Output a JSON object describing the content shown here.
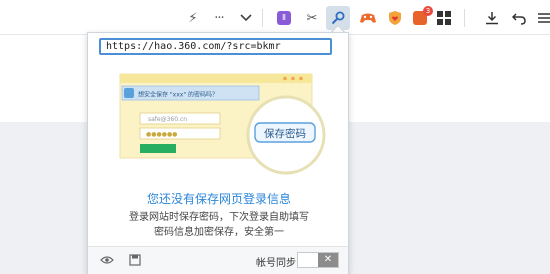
{
  "toolbar": {
    "icons": [
      {
        "name": "lightning-icon",
        "glyph": "⚡"
      },
      {
        "name": "more-icon",
        "glyph": "···"
      },
      {
        "name": "chevron-down-icon",
        "glyph": "⌄"
      },
      {
        "name": "purple-extension-icon",
        "glyph": "Ⅱ"
      },
      {
        "name": "scissors-icon",
        "glyph": "✂"
      },
      {
        "name": "password-key-icon",
        "glyph": "⚲"
      },
      {
        "name": "game-controller-icon",
        "glyph": "🎮"
      },
      {
        "name": "shield-heart-icon",
        "glyph": "♥"
      },
      {
        "name": "notification-icon",
        "glyph": "🐱"
      },
      {
        "name": "apps-grid-icon",
        "glyph": "▦"
      },
      {
        "name": "download-icon",
        "glyph": "⤓"
      },
      {
        "name": "undo-icon",
        "glyph": "↶"
      },
      {
        "name": "menu-icon",
        "glyph": "≡"
      }
    ],
    "badge_count": "3",
    "accent_active": "#d5dfe9"
  },
  "popup": {
    "url": "https://hao.360.com/?src=bkmr",
    "illustration": {
      "banner_text": "想安全保存 \"xxx\" 的密码吗？",
      "account_value": "safe@360.cn",
      "password_mask": "●●●●●●",
      "magnifier_button": "保存密码"
    },
    "title": "您还没有保存网页登录信息",
    "description_line1": "登录网站时保存密码，下次登录自助填写",
    "description_line2": "密码信息加密保存，安全第一",
    "footer": {
      "sync_label": "帐号同步",
      "toggle_glyph": "✕"
    }
  },
  "colors": {
    "brand_blue": "#2b86d9",
    "url_border": "#4d8fd6",
    "illus_yellow": "#fbf3c6",
    "illus_green": "#27ae60"
  }
}
